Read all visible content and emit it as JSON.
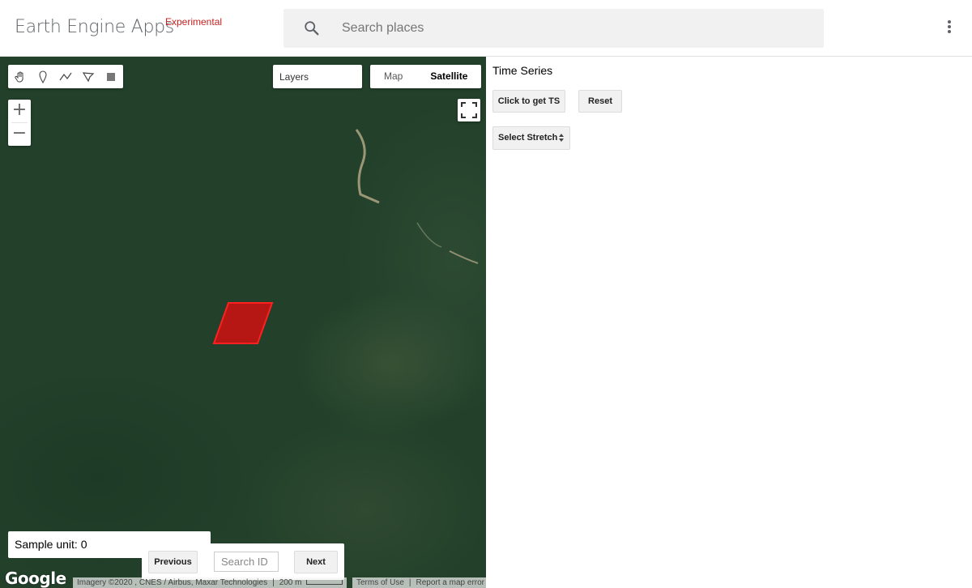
{
  "header": {
    "brand": "Earth Engine Apps",
    "badge": "Experimental",
    "search_placeholder": "Search places"
  },
  "map": {
    "layers_label": "Layers",
    "map_type_options": [
      "Map",
      "Satellite"
    ],
    "selected_map_type": "Satellite",
    "zoom_in": "+",
    "zoom_out": "−",
    "sample_unit_text": "Sample unit: 0",
    "previous_label": "Previous",
    "search_id_placeholder": "Search ID",
    "next_label": "Next",
    "logo": "Google",
    "attribution": "Imagery ©2020 , CNES / Airbus, Maxar Technologies",
    "scale_text": "200 m",
    "terms": "Terms of Use",
    "report": "Report a map error",
    "drawing_tools": [
      "hand-icon",
      "marker-icon",
      "line-icon",
      "polygon-icon",
      "rectangle-icon"
    ],
    "polygon_color": "#d01010"
  },
  "panel": {
    "title": "Time Series",
    "get_ts_label": "Click to get TS",
    "reset_label": "Reset",
    "stretch_label": "Select Stretch"
  }
}
